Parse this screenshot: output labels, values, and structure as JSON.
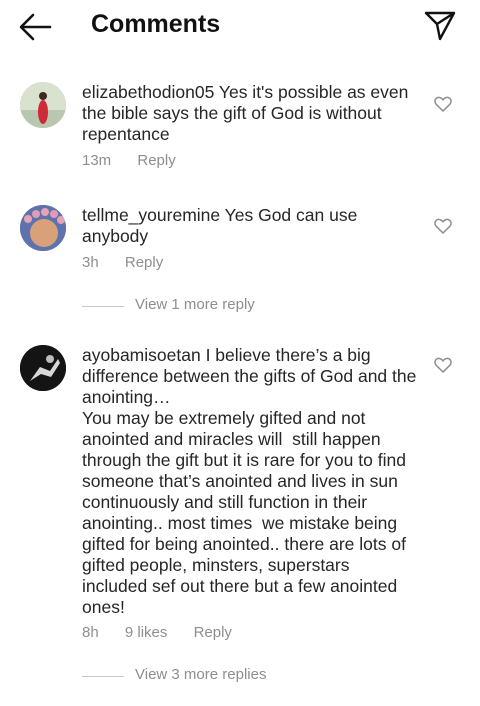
{
  "header": {
    "title": "Comments",
    "back_icon": "arrow-left-icon",
    "send_icon": "paper-plane-icon"
  },
  "comments": [
    {
      "username": "elizabethodion05",
      "text": "Yes it's possible as even the bible says the gift of God is without repentance",
      "time": "13m",
      "likes": "",
      "reply_label": "Reply",
      "avatar_colors": [
        "#c9d6c0",
        "#cf2a3a"
      ]
    },
    {
      "username": "tellme_youremine",
      "text": "Yes God can use anybody",
      "time": "3h",
      "likes": "",
      "reply_label": "Reply",
      "more_replies": "View 1 more reply",
      "avatar_colors": [
        "#6a7fb8",
        "#e6a3b8"
      ]
    },
    {
      "username": "ayobamisoetan",
      "text": "I believe there’s a big difference between the gifts of God and the anointing…\nYou may be extremely gifted and not anointed and miracles will  still happen through the gift but it is rare for you to find someone that’s anointed and lives in sun continuously and still function in their anointing.. most times  we mistake being gifted for being anointed.. there are lots of gifted people, minsters, superstars included sef out there but a few anointed ones!",
      "time": "8h",
      "likes": "9 likes",
      "reply_label": "Reply",
      "more_replies": "View 3 more replies",
      "avatar_colors": [
        "#1a1a1a",
        "#e8e8e8"
      ]
    }
  ]
}
